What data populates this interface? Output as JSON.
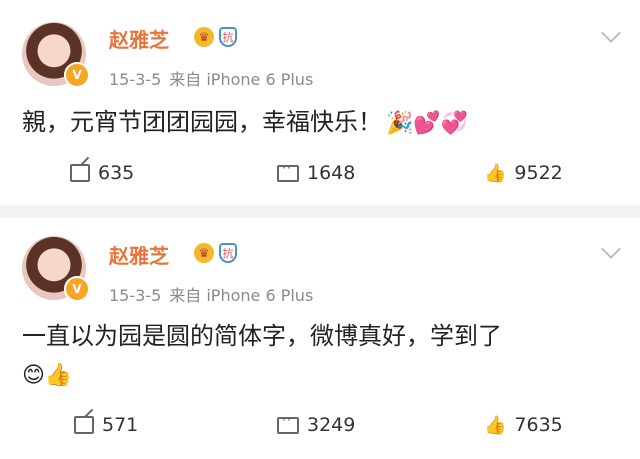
{
  "posts": [
    {
      "username": "赵雅芝",
      "date": "15-3-5",
      "source": "来自 iPhone 6 Plus",
      "text": "親，元宵节团团园园，幸福快乐！",
      "emojis": "🎉💕💞",
      "reposts": "635",
      "comments": "1648",
      "likes": "9522"
    },
    {
      "username": "赵雅芝",
      "date": "15-3-5",
      "source": "来自 iPhone 6 Plus",
      "text": "一直以为园是圆的简体字，微博真好，学到了",
      "emojis": "😊👍",
      "reposts": "571",
      "comments": "3249",
      "likes": "7635"
    }
  ],
  "icons": {
    "verified_badge": "V",
    "crown": "♛",
    "shield": "抗"
  },
  "colors": {
    "username": "#e8743b",
    "meta": "#8a8a8a",
    "separator": "#f2f2f2"
  }
}
